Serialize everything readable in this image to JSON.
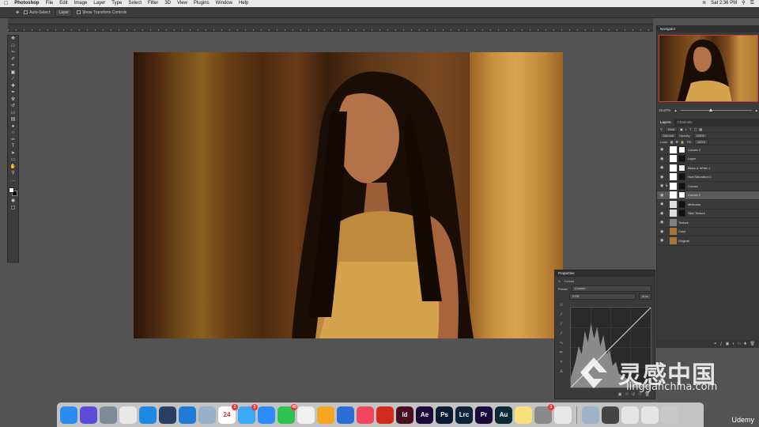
{
  "menubar": {
    "app_name": "Photoshop",
    "items": [
      "File",
      "Edit",
      "Image",
      "Layer",
      "Type",
      "Select",
      "Filter",
      "3D",
      "View",
      "Plugins",
      "Window",
      "Help"
    ],
    "clock": "Sat 2:36 PM"
  },
  "options": {
    "auto_select": "Auto-Select:",
    "layer_select": "Layer",
    "show_transform": "Show Transform Controls"
  },
  "navigator": {
    "title": "Navigator",
    "zoom": "16.67%"
  },
  "layers_panel": {
    "tabs": [
      "Layers",
      "Channels"
    ],
    "kind_label": "Kind",
    "blend_mode": "Normal",
    "opacity_label": "Opacity:",
    "opacity": "100%",
    "lock_label": "Lock:",
    "fill_label": "Fill:",
    "fill": "100%",
    "layers": [
      {
        "name": "Curves 3",
        "thumb": "#ffffff",
        "mask": "#ffffff",
        "selected": false,
        "indent": false
      },
      {
        "name": "Layer",
        "thumb": "#ffffff",
        "mask": "#111111",
        "selected": false,
        "indent": false
      },
      {
        "name": "Black & White 1",
        "thumb": "#ffffff",
        "mask": "#eeeeee",
        "selected": false,
        "indent": false
      },
      {
        "name": "Hue/Saturation 1",
        "thumb": "#ffffff",
        "mask": "#111111",
        "selected": false,
        "indent": false
      },
      {
        "name": "Curves",
        "thumb": "#ffffff",
        "mask": "#111111",
        "selected": false,
        "indent": true
      },
      {
        "name": "Curves 2",
        "thumb": "#ffffff",
        "mask": "#ffffff",
        "selected": true,
        "indent": false
      },
      {
        "name": "Midtones",
        "thumb": "#dddddd",
        "mask": "#111111",
        "selected": false,
        "indent": false
      },
      {
        "name": "Skin Texture",
        "thumb": "#dddddd",
        "mask": "#111111",
        "selected": false,
        "indent": false
      },
      {
        "name": "Texture",
        "thumb": "#808080",
        "mask": "",
        "selected": false,
        "indent": false
      },
      {
        "name": "Color",
        "thumb": "#a8743a",
        "mask": "",
        "selected": false,
        "indent": false
      },
      {
        "name": "Original",
        "thumb": "#a8743a",
        "mask": "",
        "selected": false,
        "indent": false
      }
    ]
  },
  "properties": {
    "title": "Properties",
    "type": "Curves",
    "preset_label": "Preset:",
    "preset": "Custom",
    "channel": "RGB",
    "auto": "Auto"
  },
  "watermark": {
    "cn": "灵感中国",
    "en": "lingganchina.com"
  },
  "dock": {
    "apps": [
      {
        "name": "Finder",
        "color": "#2d8cf0",
        "label": "",
        "badge": ""
      },
      {
        "name": "Siri",
        "color": "#5b4bd6",
        "label": "",
        "badge": ""
      },
      {
        "name": "Launchpad",
        "color": "#7d8a99",
        "label": "",
        "badge": ""
      },
      {
        "name": "Chrome",
        "color": "#e8e8e8",
        "label": "",
        "badge": ""
      },
      {
        "name": "Safari",
        "color": "#1e88e5",
        "label": "",
        "badge": ""
      },
      {
        "name": "QuickTime",
        "color": "#2b3e63",
        "label": "",
        "badge": ""
      },
      {
        "name": "TeamViewer",
        "color": "#1f7bd6",
        "label": "",
        "badge": ""
      },
      {
        "name": "Preview",
        "color": "#9ab0c8",
        "label": "",
        "badge": ""
      },
      {
        "name": "Calendar",
        "color": "#ffffff",
        "label": "24",
        "badge": "2"
      },
      {
        "name": "Messages",
        "color": "#3ba7f5",
        "label": "",
        "badge": "3"
      },
      {
        "name": "Zoom",
        "color": "#2d8cff",
        "label": "",
        "badge": ""
      },
      {
        "name": "WhatsApp",
        "color": "#2ec24f",
        "label": "",
        "badge": "49"
      },
      {
        "name": "TextEdit",
        "color": "#f0f0f0",
        "label": "",
        "badge": ""
      },
      {
        "name": "Pages",
        "color": "#f6a623",
        "label": "",
        "badge": ""
      },
      {
        "name": "Keynote",
        "color": "#2b6fd6",
        "label": "",
        "badge": ""
      },
      {
        "name": "Music",
        "color": "#f3465c",
        "label": "",
        "badge": ""
      },
      {
        "name": "Acrobat",
        "color": "#d42a1e",
        "label": "",
        "badge": ""
      },
      {
        "name": "InDesign",
        "color": "#4a0e22",
        "label": "Id",
        "badge": ""
      },
      {
        "name": "After Effects",
        "color": "#1a0a3a",
        "label": "Ae",
        "badge": ""
      },
      {
        "name": "Photoshop",
        "color": "#0a1b33",
        "label": "Ps",
        "badge": ""
      },
      {
        "name": "Lightroom Classic",
        "color": "#0b2238",
        "label": "Lrc",
        "badge": ""
      },
      {
        "name": "Premiere Pro",
        "color": "#1a0a3a",
        "label": "Pr",
        "badge": ""
      },
      {
        "name": "Audition",
        "color": "#0b2a38",
        "label": "Au",
        "badge": ""
      },
      {
        "name": "Notes",
        "color": "#f8e07a",
        "label": "",
        "badge": ""
      },
      {
        "name": "System Preferences",
        "color": "#8a8a8a",
        "label": "",
        "badge": "1"
      },
      {
        "name": "Creative Cloud",
        "color": "#e8e8e8",
        "label": "",
        "badge": ""
      },
      {
        "name": "Screenshot",
        "color": "#9fb2c9",
        "label": "",
        "badge": ""
      },
      {
        "name": "Photo Window",
        "color": "#444444",
        "label": "",
        "badge": ""
      },
      {
        "name": "Document",
        "color": "#e5e5e5",
        "label": "",
        "badge": ""
      },
      {
        "name": "Document 2",
        "color": "#e5e5e5",
        "label": "",
        "badge": ""
      },
      {
        "name": "Trash",
        "color": "#c8c8c8",
        "label": "",
        "badge": ""
      }
    ]
  },
  "udemy": "Udemy"
}
